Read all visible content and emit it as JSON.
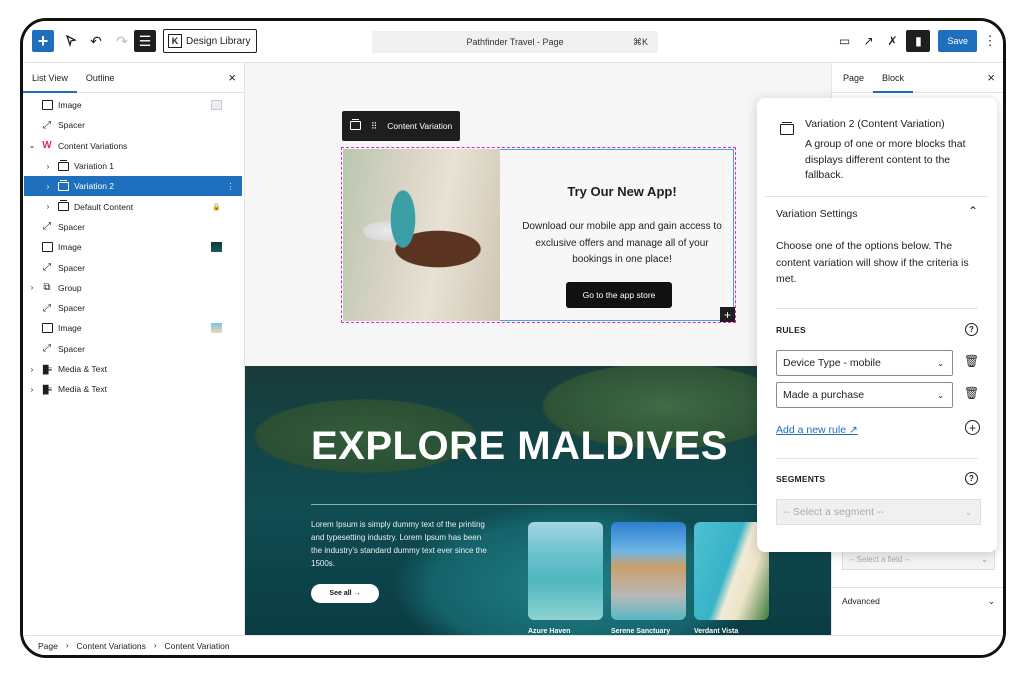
{
  "toolbar": {
    "add_icon": "+",
    "select_icon": "⮙",
    "undo_icon": "↶",
    "redo_icon": "↷",
    "list_view_icon": "☰",
    "design_library_label": "Design Library",
    "design_library_logo": "K",
    "command_bar_title": "Pathfinder Travel - Page",
    "command_shortcut": "⌘K",
    "preview_icon": "▭",
    "external_icon": "↗",
    "sparkle_icon": "✗",
    "settings_icon": "▮",
    "save_label": "Save",
    "more_icon": "⋮"
  },
  "left_panel": {
    "tabs": [
      {
        "label": "List View",
        "active": true
      },
      {
        "label": "Outline",
        "active": false
      }
    ],
    "close_icon": "×",
    "tree": [
      {
        "label": "Image",
        "icon": "image-icon",
        "trail": "thumb-doc",
        "level": 0,
        "expandable": false
      },
      {
        "label": "Spacer",
        "icon": "spacer-icon",
        "level": 0,
        "expandable": false
      },
      {
        "label": "Content Variations",
        "icon": "content-variations-logo-icon",
        "level": 0,
        "expandable": true,
        "expanded": true
      },
      {
        "label": "Variation 1",
        "icon": "variation-icon",
        "level": 1,
        "expandable": true
      },
      {
        "label": "Variation 2",
        "icon": "variation-icon",
        "level": 1,
        "expandable": true,
        "selected": true
      },
      {
        "label": "Default Content",
        "icon": "variation-icon",
        "trail": "lock",
        "level": 1,
        "expandable": true
      },
      {
        "label": "Spacer",
        "icon": "spacer-icon",
        "level": 0,
        "expandable": false
      },
      {
        "label": "Image",
        "icon": "image-icon",
        "trail": "thumb-dark",
        "level": 0,
        "expandable": false
      },
      {
        "label": "Spacer",
        "icon": "spacer-icon",
        "level": 0,
        "expandable": false
      },
      {
        "label": "Group",
        "icon": "group-icon",
        "level": 0,
        "expandable": true
      },
      {
        "label": "Spacer",
        "icon": "spacer-icon",
        "level": 0,
        "expandable": false
      },
      {
        "label": "Image",
        "icon": "image-icon",
        "trail": "thumb-beach",
        "level": 0,
        "expandable": false
      },
      {
        "label": "Spacer",
        "icon": "spacer-icon",
        "level": 0,
        "expandable": false
      },
      {
        "label": "Media & Text",
        "icon": "media-text-icon",
        "level": 0,
        "expandable": true
      },
      {
        "label": "Media & Text",
        "icon": "media-text-icon",
        "level": 0,
        "expandable": true
      }
    ]
  },
  "canvas": {
    "block_toolbar_label": "Content Variation",
    "variation": {
      "title": "Try Our New App!",
      "body": "Download our mobile app and gain access to exclusive offers and manage all of your bookings in one place!",
      "cta": "Go to the app store"
    },
    "hero": {
      "title": "EXPLORE MALDIVES",
      "text": "Lorem Ipsum is simply dummy text of the printing and typesetting industry. Lorem Ipsum has been the industry's standard dummy text ever since the 1500s.",
      "button": "See all →",
      "cards": [
        "Azure Haven",
        "Serene Sanctuary",
        "Verdant Vista"
      ]
    }
  },
  "right_panel": {
    "tabs": [
      {
        "label": "Page",
        "active": false
      },
      {
        "label": "Block",
        "active": true
      }
    ],
    "close_icon": "×",
    "field_placeholder": "-- Select a field --",
    "advanced_label": "Advanced"
  },
  "popover": {
    "title": "Variation 2 (Content Variation)",
    "description": "A group of one or more blocks that displays different content to the fallback.",
    "settings_title": "Variation Settings",
    "settings_text": "Choose one of the options below. The content variation will show if the criteria is met.",
    "rules_label": "RULES",
    "rules": [
      "Device Type - mobile",
      "Made a purchase"
    ],
    "add_rule_label": "Add a new rule ↗",
    "segments_label": "SEGMENTS",
    "segment_placeholder": "-- Select a segment --"
  },
  "footer": {
    "breadcrumb": [
      "Page",
      "Content Variations",
      "Content Variation"
    ]
  },
  "colors": {
    "accent": "#1e6fbe",
    "variation_outline": "#d62fc9",
    "brand_pink": "#e5238c"
  }
}
